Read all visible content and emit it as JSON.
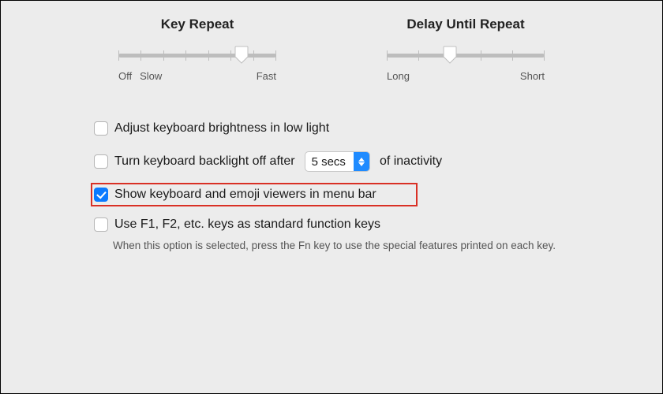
{
  "sliders": {
    "keyRepeat": {
      "title": "Key Repeat",
      "labels": {
        "off": "Off",
        "slow": "Slow",
        "fast": "Fast"
      },
      "ticks": 8,
      "valuePercent": 78
    },
    "delayUntilRepeat": {
      "title": "Delay Until Repeat",
      "labels": {
        "long": "Long",
        "short": "Short"
      },
      "ticks": 6,
      "valuePercent": 40
    }
  },
  "options": {
    "adjustBrightness": {
      "label": "Adjust keyboard brightness in low light",
      "checked": false
    },
    "backlightOff": {
      "label_pre": "Turn keyboard backlight off after",
      "select_value": "5 secs",
      "label_post": "of inactivity",
      "checked": false
    },
    "showViewers": {
      "label": "Show keyboard and emoji viewers in menu bar",
      "checked": true
    },
    "fnKeys": {
      "label": "Use F1, F2, etc. keys as standard function keys",
      "checked": false,
      "helper": "When this option is selected, press the Fn key to use the special features printed on each key."
    }
  }
}
